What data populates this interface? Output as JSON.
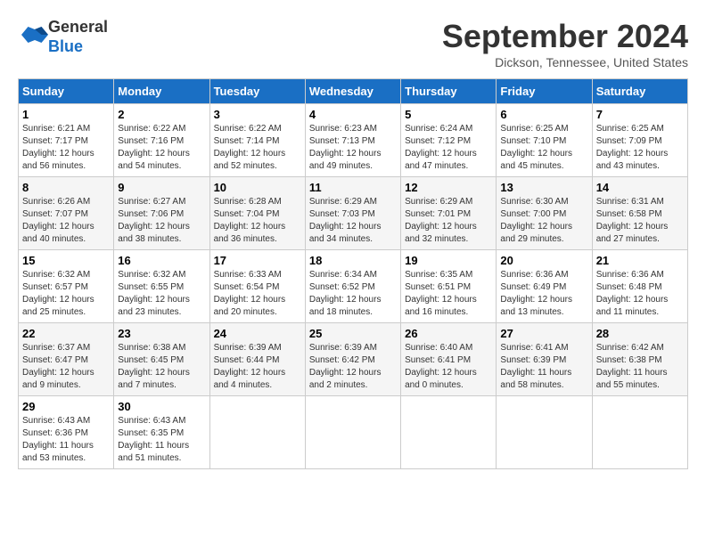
{
  "header": {
    "logo_line1": "General",
    "logo_line2": "Blue",
    "month_title": "September 2024",
    "location": "Dickson, Tennessee, United States"
  },
  "days_of_week": [
    "Sunday",
    "Monday",
    "Tuesday",
    "Wednesday",
    "Thursday",
    "Friday",
    "Saturday"
  ],
  "weeks": [
    [
      {
        "day": "1",
        "sunrise": "6:21 AM",
        "sunset": "7:17 PM",
        "daylight": "12 hours and 56 minutes."
      },
      {
        "day": "2",
        "sunrise": "6:22 AM",
        "sunset": "7:16 PM",
        "daylight": "12 hours and 54 minutes."
      },
      {
        "day": "3",
        "sunrise": "6:22 AM",
        "sunset": "7:14 PM",
        "daylight": "12 hours and 52 minutes."
      },
      {
        "day": "4",
        "sunrise": "6:23 AM",
        "sunset": "7:13 PM",
        "daylight": "12 hours and 49 minutes."
      },
      {
        "day": "5",
        "sunrise": "6:24 AM",
        "sunset": "7:12 PM",
        "daylight": "12 hours and 47 minutes."
      },
      {
        "day": "6",
        "sunrise": "6:25 AM",
        "sunset": "7:10 PM",
        "daylight": "12 hours and 45 minutes."
      },
      {
        "day": "7",
        "sunrise": "6:25 AM",
        "sunset": "7:09 PM",
        "daylight": "12 hours and 43 minutes."
      }
    ],
    [
      {
        "day": "8",
        "sunrise": "6:26 AM",
        "sunset": "7:07 PM",
        "daylight": "12 hours and 40 minutes."
      },
      {
        "day": "9",
        "sunrise": "6:27 AM",
        "sunset": "7:06 PM",
        "daylight": "12 hours and 38 minutes."
      },
      {
        "day": "10",
        "sunrise": "6:28 AM",
        "sunset": "7:04 PM",
        "daylight": "12 hours and 36 minutes."
      },
      {
        "day": "11",
        "sunrise": "6:29 AM",
        "sunset": "7:03 PM",
        "daylight": "12 hours and 34 minutes."
      },
      {
        "day": "12",
        "sunrise": "6:29 AM",
        "sunset": "7:01 PM",
        "daylight": "12 hours and 32 minutes."
      },
      {
        "day": "13",
        "sunrise": "6:30 AM",
        "sunset": "7:00 PM",
        "daylight": "12 hours and 29 minutes."
      },
      {
        "day": "14",
        "sunrise": "6:31 AM",
        "sunset": "6:58 PM",
        "daylight": "12 hours and 27 minutes."
      }
    ],
    [
      {
        "day": "15",
        "sunrise": "6:32 AM",
        "sunset": "6:57 PM",
        "daylight": "12 hours and 25 minutes."
      },
      {
        "day": "16",
        "sunrise": "6:32 AM",
        "sunset": "6:55 PM",
        "daylight": "12 hours and 23 minutes."
      },
      {
        "day": "17",
        "sunrise": "6:33 AM",
        "sunset": "6:54 PM",
        "daylight": "12 hours and 20 minutes."
      },
      {
        "day": "18",
        "sunrise": "6:34 AM",
        "sunset": "6:52 PM",
        "daylight": "12 hours and 18 minutes."
      },
      {
        "day": "19",
        "sunrise": "6:35 AM",
        "sunset": "6:51 PM",
        "daylight": "12 hours and 16 minutes."
      },
      {
        "day": "20",
        "sunrise": "6:36 AM",
        "sunset": "6:49 PM",
        "daylight": "12 hours and 13 minutes."
      },
      {
        "day": "21",
        "sunrise": "6:36 AM",
        "sunset": "6:48 PM",
        "daylight": "12 hours and 11 minutes."
      }
    ],
    [
      {
        "day": "22",
        "sunrise": "6:37 AM",
        "sunset": "6:47 PM",
        "daylight": "12 hours and 9 minutes."
      },
      {
        "day": "23",
        "sunrise": "6:38 AM",
        "sunset": "6:45 PM",
        "daylight": "12 hours and 7 minutes."
      },
      {
        "day": "24",
        "sunrise": "6:39 AM",
        "sunset": "6:44 PM",
        "daylight": "12 hours and 4 minutes."
      },
      {
        "day": "25",
        "sunrise": "6:39 AM",
        "sunset": "6:42 PM",
        "daylight": "12 hours and 2 minutes."
      },
      {
        "day": "26",
        "sunrise": "6:40 AM",
        "sunset": "6:41 PM",
        "daylight": "12 hours and 0 minutes."
      },
      {
        "day": "27",
        "sunrise": "6:41 AM",
        "sunset": "6:39 PM",
        "daylight": "11 hours and 58 minutes."
      },
      {
        "day": "28",
        "sunrise": "6:42 AM",
        "sunset": "6:38 PM",
        "daylight": "11 hours and 55 minutes."
      }
    ],
    [
      {
        "day": "29",
        "sunrise": "6:43 AM",
        "sunset": "6:36 PM",
        "daylight": "11 hours and 53 minutes."
      },
      {
        "day": "30",
        "sunrise": "6:43 AM",
        "sunset": "6:35 PM",
        "daylight": "11 hours and 51 minutes."
      },
      null,
      null,
      null,
      null,
      null
    ]
  ]
}
